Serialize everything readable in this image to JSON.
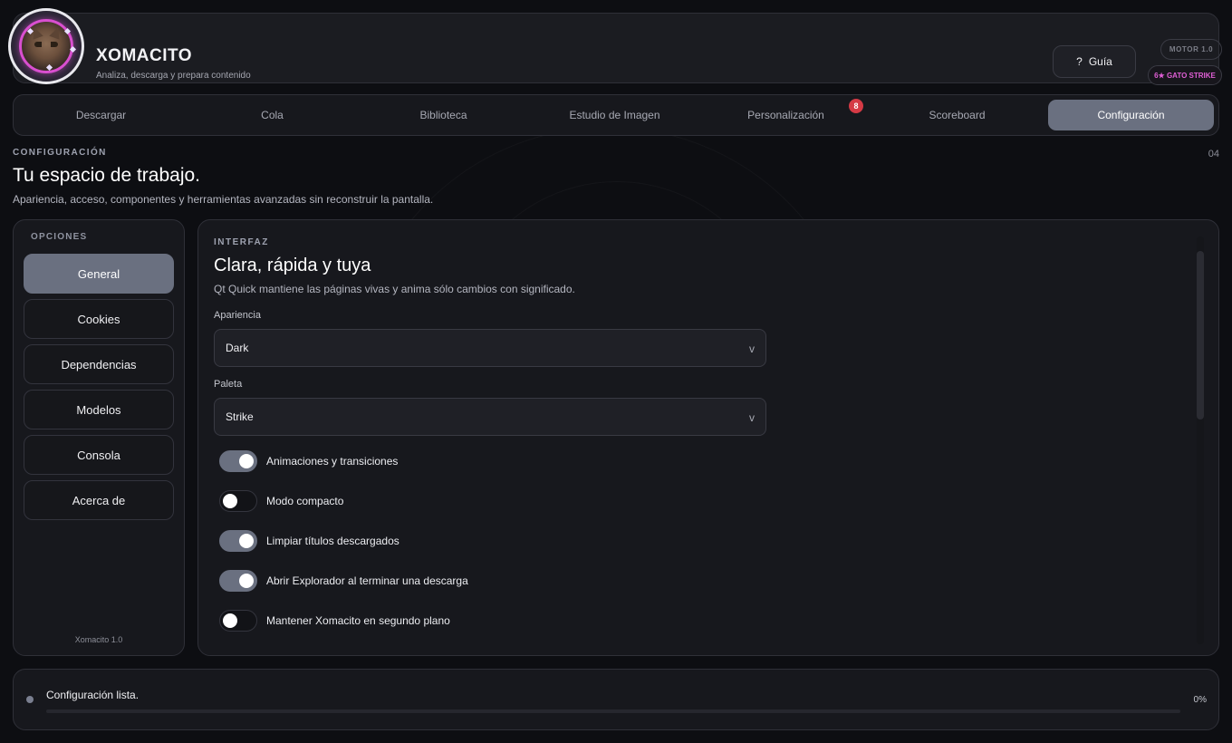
{
  "header": {
    "title": "XOMACITO",
    "subtitle": "Analiza, descarga y prepara contenido",
    "guide_icon": "?",
    "guide_label": "Guía",
    "motor_badge": "MOTOR 1.0",
    "strike_badge": "6★ GATO STRIKE"
  },
  "tabs": [
    {
      "label": "Descargar"
    },
    {
      "label": "Cola"
    },
    {
      "label": "Biblioteca"
    },
    {
      "label": "Estudio de Imagen"
    },
    {
      "label": "Personalización",
      "badge": "8"
    },
    {
      "label": "Scoreboard"
    },
    {
      "label": "Configuración",
      "active": true
    }
  ],
  "section": {
    "eyebrow": "CONFIGURACIÓN",
    "page_number": "04",
    "title": "Tu espacio de trabajo.",
    "description": "Apariencia, acceso, componentes y herramientas avanzadas sin reconstruir la pantalla."
  },
  "sidebar": {
    "heading": "OPCIONES",
    "items": [
      {
        "label": "General",
        "active": true
      },
      {
        "label": "Cookies"
      },
      {
        "label": "Dependencias"
      },
      {
        "label": "Modelos"
      },
      {
        "label": "Consola"
      },
      {
        "label": "Acerca de"
      }
    ],
    "version": "Xomacito 1.0"
  },
  "panel": {
    "eyebrow": "INTERFAZ",
    "title": "Clara, rápida y tuya",
    "description": "Qt Quick mantiene las páginas vivas y anima sólo cambios con significado.",
    "appearance_label": "Apariencia",
    "appearance_value": "Dark",
    "palette_label": "Paleta",
    "palette_value": "Strike",
    "chevron": "v",
    "toggles": [
      {
        "label": "Animaciones y transiciones",
        "on": true
      },
      {
        "label": "Modo compacto",
        "on": false
      },
      {
        "label": "Limpiar títulos descargados",
        "on": true
      },
      {
        "label": "Abrir Explorador al terminar una descarga",
        "on": true
      },
      {
        "label": "Mantener Xomacito en segundo plano",
        "on": false
      }
    ]
  },
  "status": {
    "message": "Configuración lista.",
    "progress": 0,
    "progress_label": "0%"
  },
  "colors": {
    "accent": "#6a7080",
    "strike": "#e05fd6",
    "badge": "#d53a45"
  }
}
